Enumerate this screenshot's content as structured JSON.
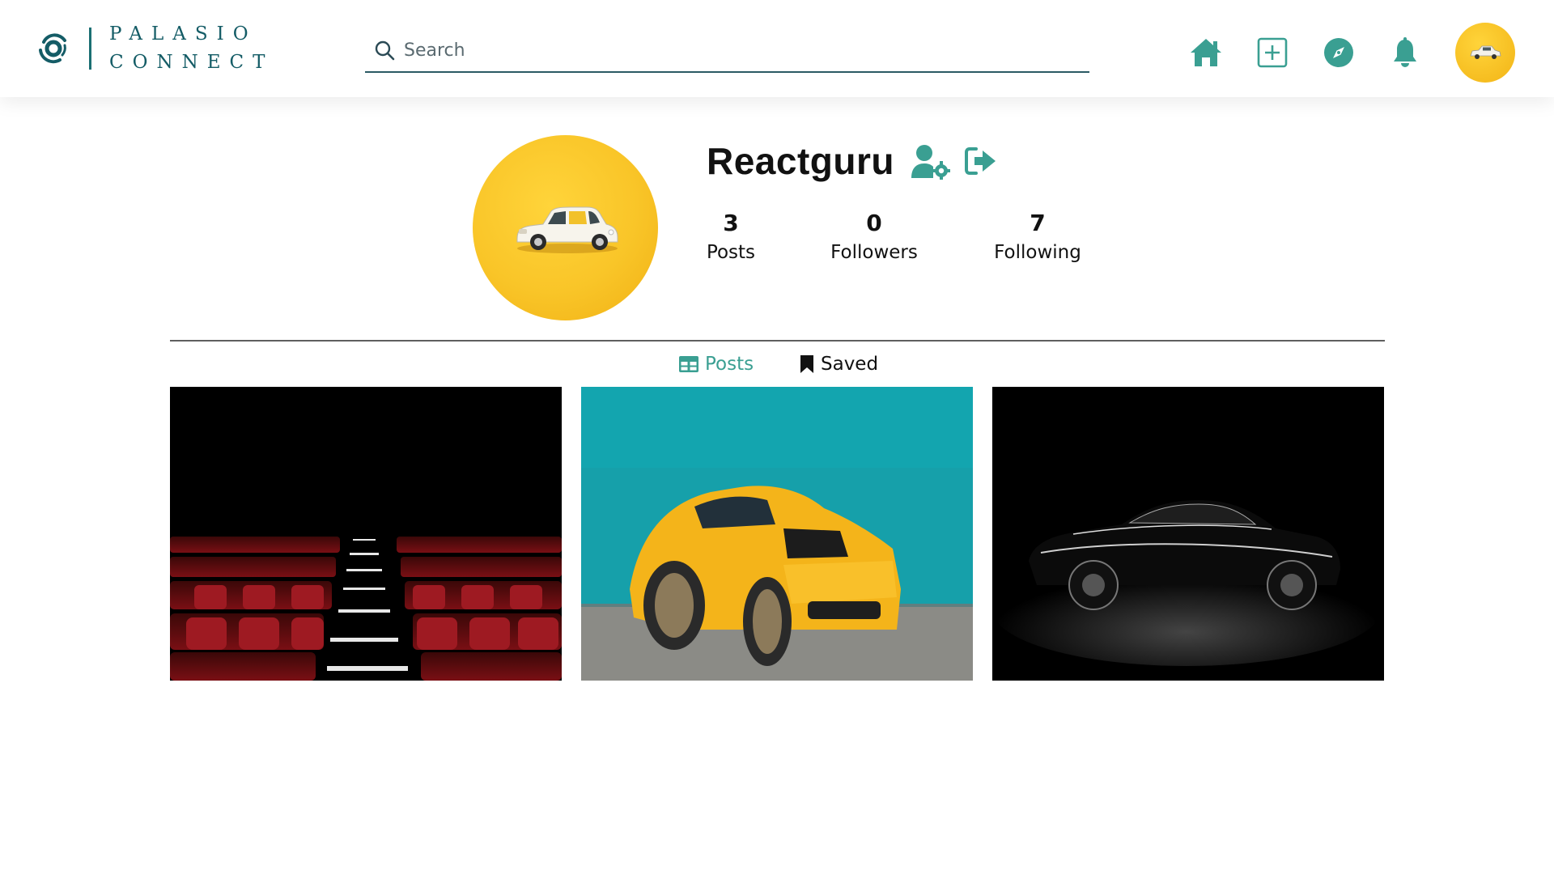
{
  "brand": {
    "line1": "PALASIO",
    "line2": "CONNECT",
    "accent_color": "#3a9f92",
    "dark_teal": "#145c66"
  },
  "search": {
    "placeholder": "Search",
    "value": "",
    "icon": "search-icon"
  },
  "nav": {
    "icons": [
      "home-icon",
      "add-post-icon",
      "explore-compass-icon",
      "notifications-bell-icon"
    ],
    "avatar": "profile-avatar-thumbnail"
  },
  "profile": {
    "username": "Reactguru",
    "settings_icon": "user-settings-icon",
    "logout_icon": "logout-icon",
    "stats": {
      "posts": {
        "count": "3",
        "label": "Posts"
      },
      "followers": {
        "count": "0",
        "label": "Followers"
      },
      "following": {
        "count": "7",
        "label": "Following"
      }
    }
  },
  "tabs": {
    "posts": {
      "label": "Posts",
      "icon": "grid-icon",
      "active": true
    },
    "saved": {
      "label": "Saved",
      "icon": "bookmark-icon",
      "active": false
    }
  },
  "posts": [
    {
      "name": "post-cinema-seats"
    },
    {
      "name": "post-yellow-sports-car"
    },
    {
      "name": "post-black-sedan"
    }
  ]
}
